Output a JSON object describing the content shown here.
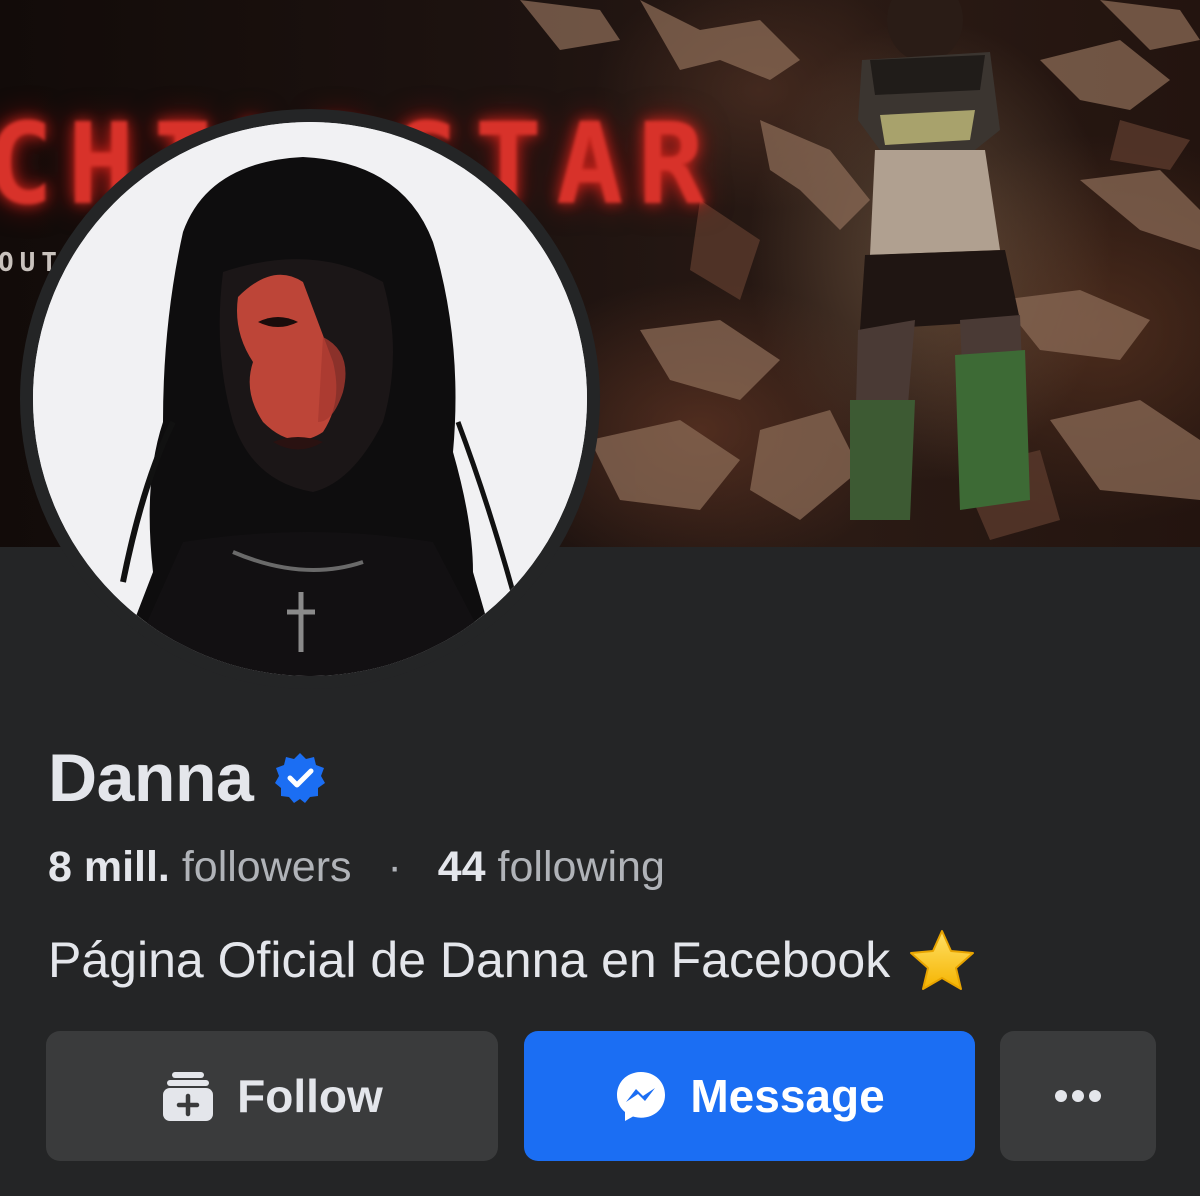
{
  "cover": {
    "title_text": "CHILDSTAR",
    "date_text": "OUT          APRIL 11"
  },
  "profile": {
    "name": "Danna",
    "verified_icon": "verified-badge-icon",
    "followers_count": "8 mill.",
    "followers_label": "followers",
    "separator": "·",
    "following_count": "44",
    "following_label": "following",
    "bio": "Página Oficial de Danna en Facebook",
    "bio_emoji_icon": "star-emoji-icon"
  },
  "actions": {
    "follow_label": "Follow",
    "follow_icon": "follow-page-plus-icon",
    "message_label": "Message",
    "message_icon": "messenger-icon",
    "more_icon": "more-dots-icon"
  },
  "colors": {
    "background": "#242526",
    "button_secondary": "#3a3b3c",
    "button_primary": "#1b6ef3",
    "verified_blue": "#1b6ef3",
    "text_primary": "#e4e6eb",
    "text_secondary": "#b0b3b8"
  }
}
